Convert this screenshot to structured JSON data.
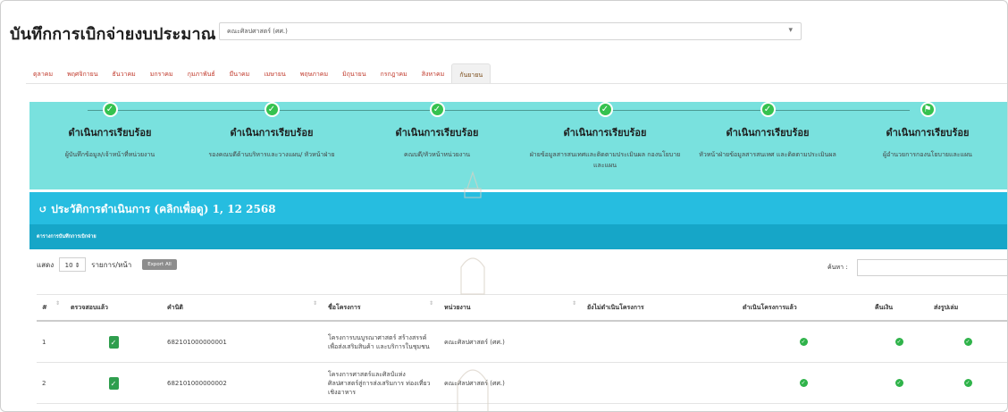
{
  "page": {
    "title": "บันทึกการเบิกจ่ายงบประมาณ",
    "faculty_select": "คณะศิลปศาสตร์ (ศศ.)"
  },
  "tabs": [
    "ตุลาคม",
    "พฤศจิกายน",
    "ธันวาคม",
    "มกราคม",
    "กุมภาพันธ์",
    "มีนาคม",
    "เมษายน",
    "พฤษภาคม",
    "มิถุนายน",
    "กรกฎาคม",
    "สิงหาคม",
    "กันยายน"
  ],
  "active_tab": "กันยายน",
  "steps": [
    {
      "status": "ดำเนินการเรียบร้อย",
      "role": "ผู้บันทึกข้อมูล/เจ้าหน้าที่หน่วยงาน"
    },
    {
      "status": "ดำเนินการเรียบร้อย",
      "role": "รองคณบดีด้านบริหารและวางแผน/ หัวหน้าฝ่าย"
    },
    {
      "status": "ดำเนินการเรียบร้อย",
      "role": "คณบดี/หัวหน้าหน่วยงาน"
    },
    {
      "status": "ดำเนินการเรียบร้อย",
      "role": "ฝ่ายข้อมูลสารสนเทศและติดตามประเมินผล กองนโยบายและแผน"
    },
    {
      "status": "ดำเนินการเรียบร้อย",
      "role": "หัวหน้าฝ่ายข้อมูลสารสนเทศ และติดตามประเมินผล"
    },
    {
      "status": "ดำเนินการเรียบร้อย",
      "role": "ผู้อำนวยการกองนโยบายและแผน"
    }
  ],
  "history": {
    "label": "ประวัติการดำเนินการ (คลิกเพื่อดู) 1, 12 2568",
    "subheader": "ตารางการบันทึกการเบิกจ่าย"
  },
  "controls": {
    "show_label": "แสดง",
    "page_length": "10",
    "per_page_label": "รายการ/หน้า",
    "export_label": "Export All",
    "search_label": "ค้นหา :"
  },
  "table": {
    "columns": [
      "#",
      "ตรวจสอบแล้ว",
      "คำนิติ",
      "ชื่อโครงการ",
      "หน่วยงาน",
      "ยังไม่ดำเนินโครงการ",
      "ดำเนินโครงการแล้ว",
      "คืนเงิน",
      "ส่งรูปเล่ม"
    ],
    "rows": [
      {
        "num": "1",
        "code": "682101000000001",
        "project": "โครงการบนบูรณาศาสตร์ สร้างสรรค์เพื่อส่งเสริมสินค้า และบริการในชุมชน",
        "unit": "คณะศิลปศาสตร์ (ศศ.)"
      },
      {
        "num": "2",
        "code": "682101000000002",
        "project": "โครงการศาสตร์และศิลป์แห่ง ศิลปศาสตร์สู่การส่งเสริมการ ท่องเที่ยวเชิงอาหาร",
        "unit": "คณะศิลปศาสตร์ (ศศ.)"
      }
    ]
  },
  "colors": {
    "accent_green": "#2fb34a",
    "steps_bg": "#79e1de",
    "history_bg": "#26bde0",
    "tab_text": "#c0392b"
  },
  "icons": {
    "step": "check-circle-icon",
    "last_step": "flag-icon",
    "history": "history-icon",
    "verified": "clipboard-check-icon",
    "done": "check-circle-icon"
  }
}
